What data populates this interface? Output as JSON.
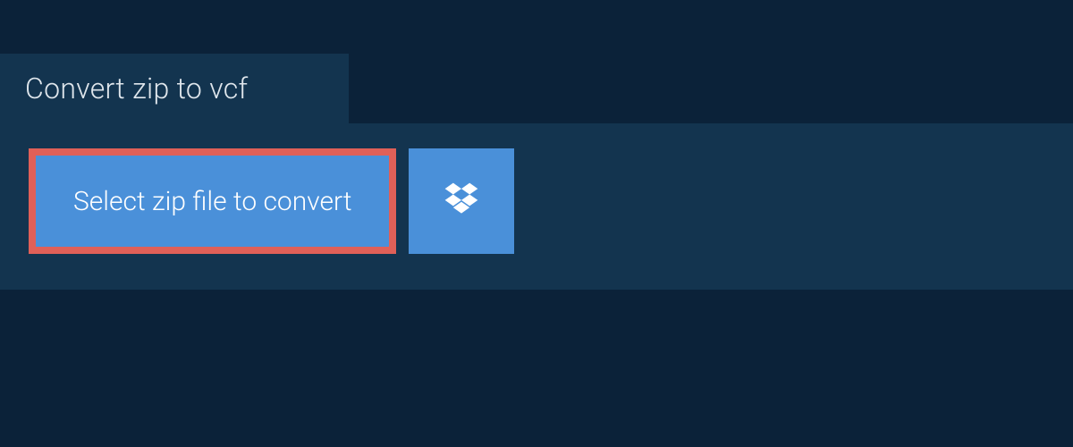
{
  "tab": {
    "title": "Convert zip to vcf"
  },
  "actions": {
    "select_file_label": "Select zip file to convert"
  },
  "colors": {
    "bg_outer": "#0b2239",
    "bg_panel": "#13344f",
    "button_blue": "#4a90d9",
    "highlight_border": "#e06058",
    "text_light": "#dfe6ec"
  }
}
